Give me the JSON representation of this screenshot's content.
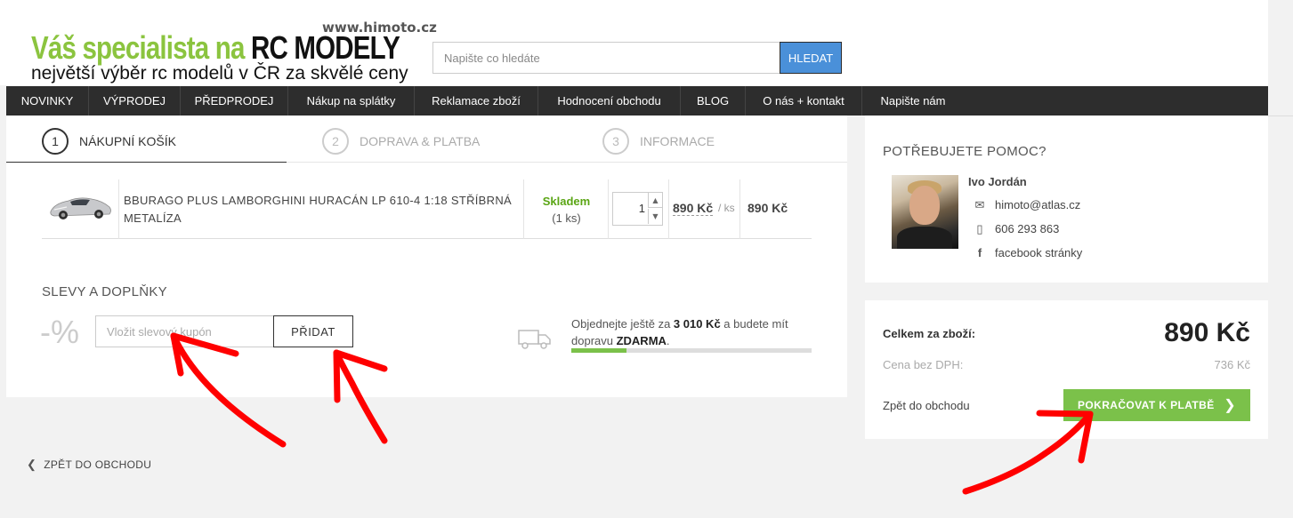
{
  "header": {
    "site_url": "www.himoto.cz",
    "slogan_part1": "Váš specialista na ",
    "slogan_part2": "RC MODELY",
    "tagline": "největší výběr rc modelů v ČR za skvělé ceny",
    "search_placeholder": "Napište co hledáte",
    "search_button": "HLEDAT"
  },
  "nav": {
    "items": [
      {
        "label": "NOVINKY"
      },
      {
        "label": "VÝPRODEJ"
      },
      {
        "label": "PŘEDPRODEJ"
      },
      {
        "label": "Nákup na splátky"
      },
      {
        "label": "Reklamace zboží"
      },
      {
        "label": "Hodnocení obchodu"
      },
      {
        "label": "BLOG"
      },
      {
        "label": "O nás + kontakt"
      },
      {
        "label": "Napište nám"
      }
    ]
  },
  "steps": [
    {
      "number": "1",
      "label": "NÁKUPNÍ KOŠÍK",
      "active": true
    },
    {
      "number": "2",
      "label": "DOPRAVA & PLATBA",
      "active": false
    },
    {
      "number": "3",
      "label": "INFORMACE",
      "active": false
    }
  ],
  "cart": {
    "item": {
      "name": "BBURAGO PLUS LAMBORGHINI HURACÁN LP 610-4 1:18 STŘÍBRNÁ METALÍZA",
      "stock_status": "Skladem",
      "stock_qty": "(1 ks)",
      "quantity": "1",
      "unit_price": "890 Kč",
      "unit_label": "/ ks",
      "total_price": "890 Kč"
    }
  },
  "discounts": {
    "title": "SLEVY A DOPLŇKY",
    "percent_symbol": "-%",
    "coupon_placeholder": "Vložit slevový kupón",
    "add_button": "PŘIDAT"
  },
  "shipping": {
    "text_before": "Objednejte ještě za ",
    "amount": "3 010 Kč",
    "text_middle": " a budete mít dopravu ",
    "free_word": "ZDARMA",
    "text_end": ".",
    "progress": 0.23
  },
  "help": {
    "title": "POTŘEBUJETE POMOC?",
    "name": "Ivo Jordán",
    "email": "himoto@atlas.cz",
    "phone": "606 293 863",
    "facebook": "facebook stránky"
  },
  "summary": {
    "total_label": "Celkem za zboží:",
    "total_value": "890 Kč",
    "vat_label": "Cena bez DPH:",
    "vat_value": "736 Kč",
    "back_link": "Zpět do obchodu",
    "continue_button": "POKRAČOVAT K PLATBĚ"
  },
  "footer": {
    "back_to_shop": "ZPĚT DO OBCHODU"
  },
  "colors": {
    "accent_green": "#7bc14a",
    "stock_green": "#5aa514",
    "search_blue": "#4a90d9",
    "nav_dark": "#2d2d2d",
    "annotation_red": "#ff0000"
  }
}
